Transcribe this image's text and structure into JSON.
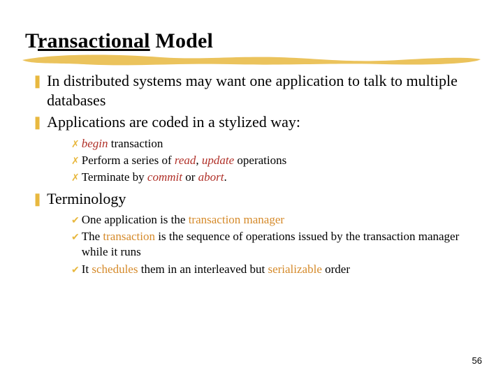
{
  "title": {
    "pre": "T",
    "underlined": "ransactional",
    "post": " Model"
  },
  "bullets": {
    "b1": "In distributed systems may want one application to talk to multiple databases",
    "b2": "Applications are coded in a stylized way:",
    "b2a_em": "begin",
    "b2a_rest": " transaction",
    "b2b_pre": "Perform a series of ",
    "b2b_read": "read",
    "b2b_sep": ", ",
    "b2b_update": "update",
    "b2b_post": " operations",
    "b2c_pre": "Terminate by ",
    "b2c_commit": "commit",
    "b2c_or": " or ",
    "b2c_abort": "abort",
    "b2c_post": ".",
    "b3": "Terminology",
    "b3a_pre": "One application is the ",
    "b3a_em": "transaction manager",
    "b3b_pre": "The ",
    "b3b_em": "transaction",
    "b3b_post": " is the sequence of operations issued by the transaction manager while it runs",
    "b3c_pre": "It ",
    "b3c_em1": "schedules",
    "b3c_mid": " them in an interleaved but ",
    "b3c_em2": "serializable",
    "b3c_post": " order"
  },
  "pagenum": "56"
}
